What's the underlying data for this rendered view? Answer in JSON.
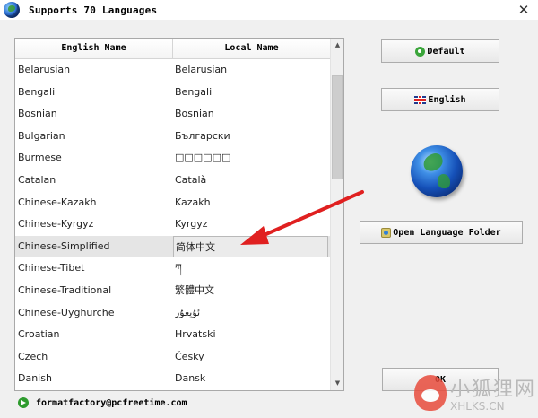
{
  "window": {
    "title": "Supports 70 Languages",
    "close_glyph": "✕"
  },
  "table": {
    "headers": {
      "english": "English Name",
      "local": "Local Name"
    },
    "rows": [
      {
        "english": "Belarusian",
        "local": "Belarusian"
      },
      {
        "english": "Bengali",
        "local": "Bengali"
      },
      {
        "english": "Bosnian",
        "local": "Bosnian"
      },
      {
        "english": "Bulgarian",
        "local": "Български"
      },
      {
        "english": "Burmese",
        "local": "□□□□□□"
      },
      {
        "english": "Catalan",
        "local": "Català"
      },
      {
        "english": "Chinese-Kazakh",
        "local": "Kazakh"
      },
      {
        "english": "Chinese-Kyrgyz",
        "local": "Kyrgyz"
      },
      {
        "english": "Chinese-Simplified",
        "local": "简体中文"
      },
      {
        "english": "Chinese-Tibet",
        "local": "ཀ"
      },
      {
        "english": "Chinese-Traditional",
        "local": "繁體中文"
      },
      {
        "english": "Chinese-Uyghurche",
        "local": "ئۇيغۇر"
      },
      {
        "english": "Croatian",
        "local": "Hrvatski"
      },
      {
        "english": "Czech",
        "local": "Česky"
      },
      {
        "english": "Danish",
        "local": "Dansk"
      }
    ]
  },
  "buttons": {
    "default": "Default",
    "english": "English",
    "open_folder": "Open Language Folder",
    "ok": "OK"
  },
  "status": {
    "email": "formatfactory@pcfreetime.com"
  },
  "watermark": {
    "cn": "小狐狸网",
    "url": "XHLKS.CN"
  },
  "colors": {
    "arrow": "#e02020",
    "selected_row": "#e5e5e5"
  },
  "icons": {
    "app": "globe-icon",
    "default": "green-circle-icon",
    "english": "uk-flag-icon",
    "folder": "folder-icon",
    "status": "green-arrow-icon"
  }
}
